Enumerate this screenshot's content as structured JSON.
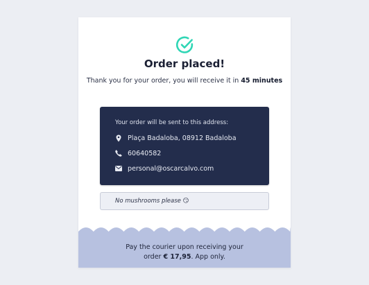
{
  "confirmation": {
    "icon": "check-circle-icon",
    "title": "Order placed!",
    "message_prefix": "Thank you for your order, you will receive it in",
    "delivery_time": "45 minutes"
  },
  "address_panel": {
    "heading": "Your order will be sent to this address:",
    "items": [
      {
        "icon": "location-pin-icon",
        "value": "Plaça Badaloba, 08912 Badaloba"
      },
      {
        "icon": "phone-icon",
        "value": "60640582"
      },
      {
        "icon": "envelope-icon",
        "value": "personal@oscarcalvo.com"
      }
    ]
  },
  "note": {
    "text": "No mushrooms please",
    "emoji": "😏"
  },
  "payment": {
    "line1": "Pay the courier upon receiving your",
    "line2_prefix": "order",
    "amount": "€ 17,95",
    "line2_suffix": ". App only."
  },
  "colors": {
    "background": "#eceef3",
    "accent_teal": "#2fd6b5",
    "panel_navy": "#232d4c",
    "footer_wave": "#b7c1e0"
  }
}
